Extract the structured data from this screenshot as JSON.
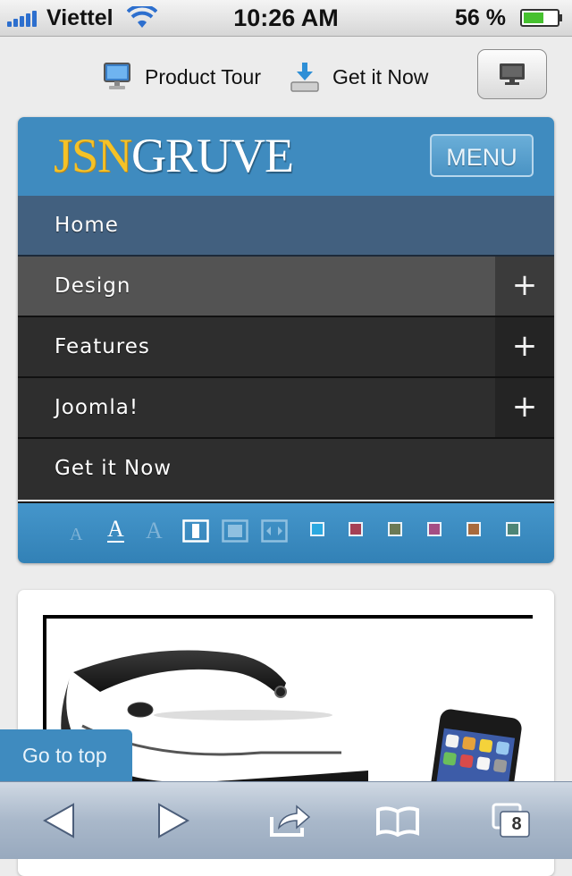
{
  "status_bar": {
    "carrier": "Viettel",
    "time": "10:26 AM",
    "battery": "56 %",
    "signal_icon": "signal-bars-icon",
    "wifi_icon": "wifi-icon",
    "battery_icon": "battery-icon"
  },
  "top_links": {
    "product_tour": "Product Tour",
    "get_it_now": "Get it Now",
    "desktop_icon": "desktop-monitor-icon"
  },
  "site": {
    "logo_part1": "JSN",
    "logo_part2": "GRUVE",
    "menu_button": "MENU",
    "colors": {
      "brand_blue": "#3f8bbf",
      "logo_yellow": "#f5c227",
      "home_row": "#42607f",
      "menu_dark": "#2e2e2e"
    }
  },
  "menu": {
    "items": [
      {
        "label": "Home",
        "expandable": false
      },
      {
        "label": "Design",
        "expandable": true,
        "expand_symbol": "+"
      },
      {
        "label": "Features",
        "expandable": true,
        "expand_symbol": "+"
      },
      {
        "label": "Joomla!",
        "expandable": true,
        "expand_symbol": "+"
      },
      {
        "label": "Get it Now",
        "expandable": false
      }
    ]
  },
  "tools": {
    "font_small": "A",
    "font_medium": "A",
    "font_large": "A",
    "layout_icons": [
      "narrow-width-icon",
      "medium-width-icon",
      "wide-width-icon"
    ],
    "color_swatches": [
      "#2ba8e0",
      "#a54055",
      "#6b7a55",
      "#a44e84",
      "#a86a3c",
      "#4d8577"
    ]
  },
  "content": {
    "hero_image": "glasses-and-phone-image"
  },
  "go_to_top": "Go to top",
  "toolbar": {
    "tabs_count": "8",
    "icons": [
      "back-icon",
      "forward-icon",
      "share-icon",
      "bookmarks-icon",
      "tabs-icon"
    ]
  }
}
